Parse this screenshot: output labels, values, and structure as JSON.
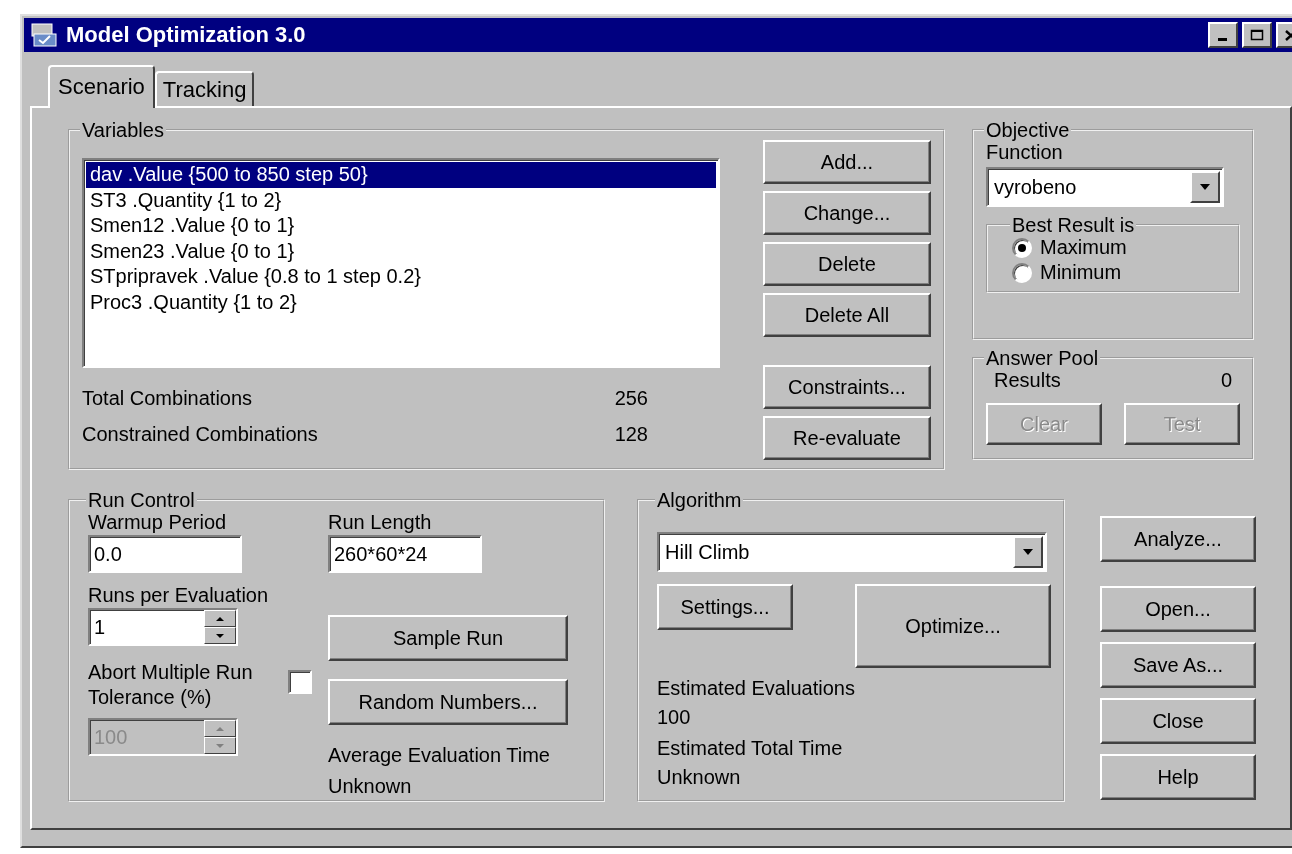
{
  "window": {
    "title": "Model Optimization 3.0"
  },
  "tabs": [
    {
      "label": "Scenario",
      "selected": true
    },
    {
      "label": "Tracking",
      "selected": false
    }
  ],
  "variables": {
    "title": "Variables",
    "items": [
      {
        "text": "dav .Value {500 to 850 step 50}",
        "selected": true
      },
      {
        "text": "ST3 .Quantity {1 to 2}",
        "selected": false
      },
      {
        "text": "Smen12 .Value {0 to 1}",
        "selected": false
      },
      {
        "text": "Smen23 .Value {0 to 1}",
        "selected": false
      },
      {
        "text": "STpripravek .Value {0.8 to 1 step 0.2}",
        "selected": false
      },
      {
        "text": "Proc3 .Quantity {1 to 2}",
        "selected": false
      }
    ],
    "totals": [
      {
        "label": "Total Combinations",
        "value": "256"
      },
      {
        "label": "Constrained Combinations",
        "value": "128"
      }
    ],
    "buttons": [
      {
        "label": "Add...",
        "disabled": false
      },
      {
        "label": "Change...",
        "disabled": false
      },
      {
        "label": "Delete",
        "disabled": false
      },
      {
        "label": "Delete All",
        "disabled": false
      }
    ],
    "buttons_lower": [
      {
        "label": "Constraints...",
        "disabled": false
      },
      {
        "label": "Re-evaluate",
        "disabled": false
      }
    ]
  },
  "objective": {
    "title": "Objective",
    "function_label": "Function",
    "function_value": "vyrobeno",
    "best_title": "Best Result is",
    "options": [
      {
        "label": "Maximum",
        "selected": true
      },
      {
        "label": "Minimum",
        "selected": false
      }
    ]
  },
  "answer_pool": {
    "title": "Answer Pool",
    "results_label": "Results",
    "results_value": "0",
    "buttons": [
      {
        "label": "Clear",
        "disabled": true
      },
      {
        "label": "Test",
        "disabled": true
      }
    ]
  },
  "run_control": {
    "title": "Run Control",
    "warmup_label": "Warmup Period",
    "warmup_value": "0.0",
    "run_length_label": "Run Length",
    "run_length_value": "260*60*24",
    "runs_label": "Runs per Evaluation",
    "runs_value": "1",
    "abort_label": "Abort Multiple Run Tolerance (%)",
    "abort_checked": false,
    "tolerance_value": "100",
    "tolerance_disabled": true,
    "sample_button": "Sample Run",
    "random_button": "Random Numbers...",
    "avg_label": "Average Evaluation Time",
    "avg_value": "Unknown"
  },
  "algorithm": {
    "title": "Algorithm",
    "value": "Hill Climb",
    "settings_button": "Settings...",
    "optimize_button": "Optimize...",
    "est_eval_label": "Estimated Evaluations",
    "est_eval_value": "100",
    "est_time_label": "Estimated Total Time",
    "est_time_value": "Unknown"
  },
  "side_buttons": [
    {
      "label": "Analyze...",
      "disabled": false
    },
    {
      "label": "Open...",
      "disabled": false
    },
    {
      "label": "Save As...",
      "disabled": false
    },
    {
      "label": "Close",
      "disabled": false
    },
    {
      "label": "Help",
      "disabled": false
    }
  ]
}
